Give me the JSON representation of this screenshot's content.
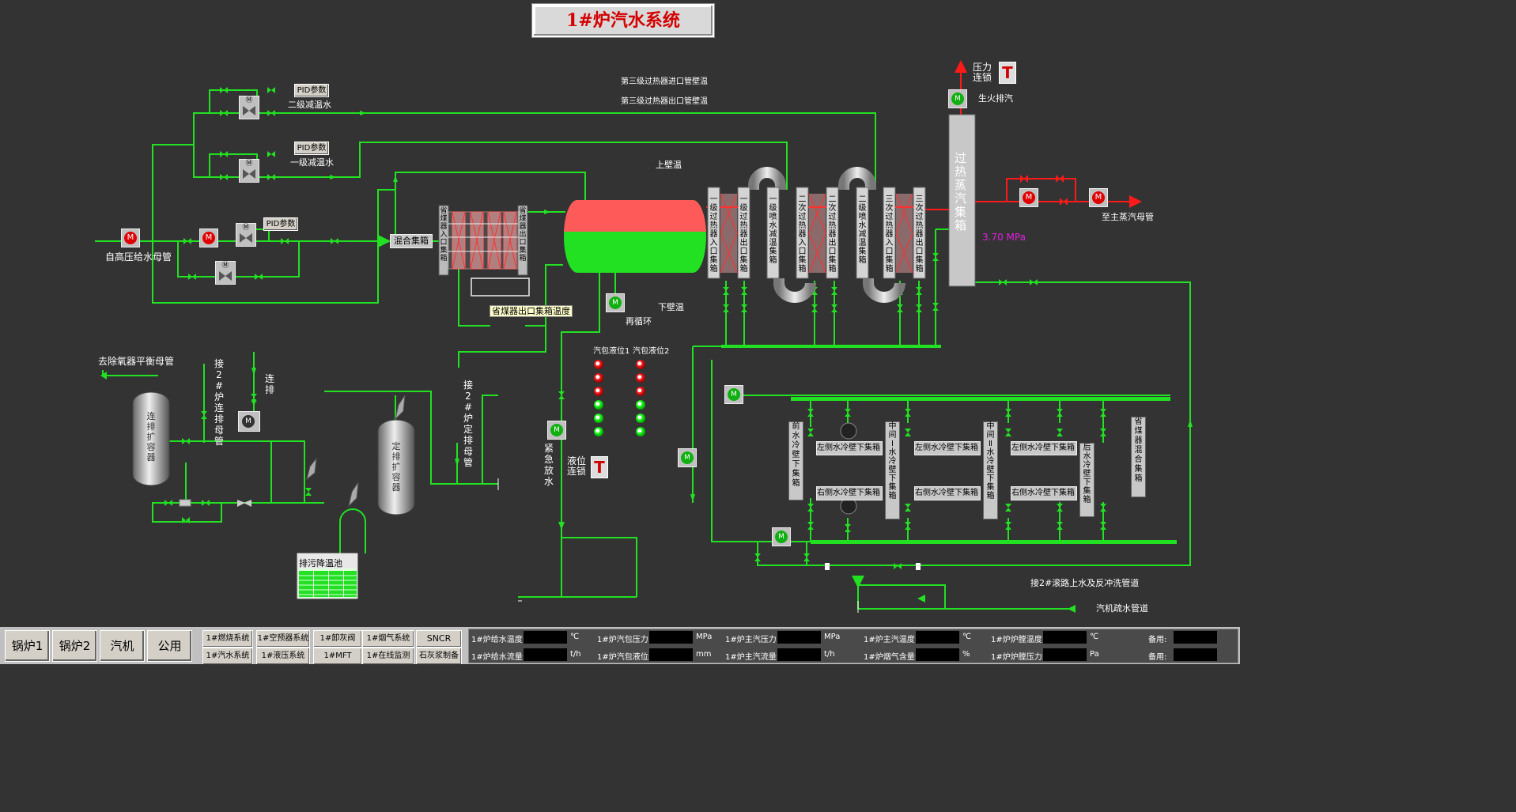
{
  "title": "1#炉汽水系统",
  "labels": {
    "feedwater_in": "自高压给水母管",
    "stage2_desup": "二级减温水",
    "stage1_desup": "一级减温水",
    "pid1": "PID参数",
    "pid2": "PID参数",
    "pid3": "PID参数",
    "sh3_in_temp": "第三级过热器进口管壁温",
    "sh3_out_temp": "第三级过热器出口管壁温",
    "upper_wall_temp": "上壁温",
    "lower_wall_temp": "下壁温",
    "recirc": "再循环",
    "mix_header": "混合集箱",
    "eco_out_temp": "省煤器出口集箱温度",
    "pressure_interlock": "压力连锁",
    "startup_vent": "生火排汽",
    "to_main_steam": "至主蒸汽母管",
    "pressure_value": "3.70 MPa",
    "deaerator": "去除氧器平衡母管",
    "drum_level1": "汽包液位1",
    "drum_level2": "汽包液位2",
    "level_interlock": "液位连锁",
    "blowdown_pool": "排污降温池",
    "slag_water_line": "接2#滚路上水及反冲洗管道",
    "mill_drain": "汽机疏水管道",
    "cont_blow_tank": "连排扩容器",
    "periodic_blow_tank": "定排扩容器",
    "link2_cont": "接2#炉连排母管",
    "cont_blow": "连排",
    "link2_periodic": "接2#炉定排母管",
    "emergency_drain": "紧急放水",
    "superheated_header": "过热蒸汽集箱",
    "eco_in_header": "省煤器入口集箱",
    "eco_out_header": "省煤器出口集箱",
    "sh1_in": "一级过热器入口集箱",
    "sh1_out": "一级过热器出口集箱",
    "spray1": "一级喷水减温集箱",
    "sh2_in": "二次过热器入口集箱",
    "sh2_out": "二次过热器出口集箱",
    "spray2": "二级喷水减温集箱",
    "sh3_in": "三次过热器入口集箱",
    "sh3_out": "三次过热器出口集箱",
    "front_wall": "前水冷壁下集箱",
    "mid1_wall": "中间Ⅰ水冷壁下集箱",
    "mid2_wall": "中间Ⅱ水冷壁下集箱",
    "rear_wall": "后水冷壁下集箱",
    "eco_mix": "省煤器混合集箱",
    "left_wall_a": "左侧水冷壁下集箱",
    "left_wall_b": "左侧水冷壁下集箱",
    "left_wall_c": "左侧水冷壁下集箱",
    "right_wall_a": "右侧水冷壁下集箱",
    "right_wall_b": "右侧水冷壁下集箱",
    "right_wall_c": "右侧水冷壁下集箱"
  },
  "nav": [
    "锅炉1",
    "锅炉2",
    "汽机",
    "公用"
  ],
  "systems": [
    [
      "1#燃烧系统",
      "1#空预器系统",
      "1#卸灰阀",
      "1#烟气系统",
      "SNCR"
    ],
    [
      "1#汽水系统",
      "1#液压系统",
      "1#MFT",
      "1#在线监测",
      "石灰浆制备"
    ]
  ],
  "params_row1": [
    {
      "label": "1#炉给水温度:",
      "unit": "℃"
    },
    {
      "label": "1#炉汽包压力:",
      "unit": "MPa"
    },
    {
      "label": "1#炉主汽压力:",
      "unit": "MPa"
    },
    {
      "label": "1#炉主汽温度:",
      "unit": "℃"
    },
    {
      "label": "1#炉炉膛温度:",
      "unit": "℃"
    },
    {
      "label": "备用:",
      "unit": ""
    }
  ],
  "params_row2": [
    {
      "label": "1#炉给水流量:",
      "unit": "t/h"
    },
    {
      "label": "1#炉汽包液位:",
      "unit": "mm"
    },
    {
      "label": "1#炉主汽流量:",
      "unit": "t/h"
    },
    {
      "label": "1#炉烟气含量:",
      "unit": "%"
    },
    {
      "label": "1#炉炉膛压力:",
      "unit": "Pa"
    },
    {
      "label": "备用:",
      "unit": ""
    }
  ],
  "colors": {
    "pipe": "#22e022",
    "steam": "#ff1a1a",
    "bg": "#333333",
    "pressure": "#e020e0"
  },
  "drum_level1_lamps": [
    "red",
    "red",
    "red",
    "green",
    "green",
    "green"
  ],
  "drum_level2_lamps": [
    "red",
    "red",
    "red",
    "green",
    "green",
    "green"
  ]
}
